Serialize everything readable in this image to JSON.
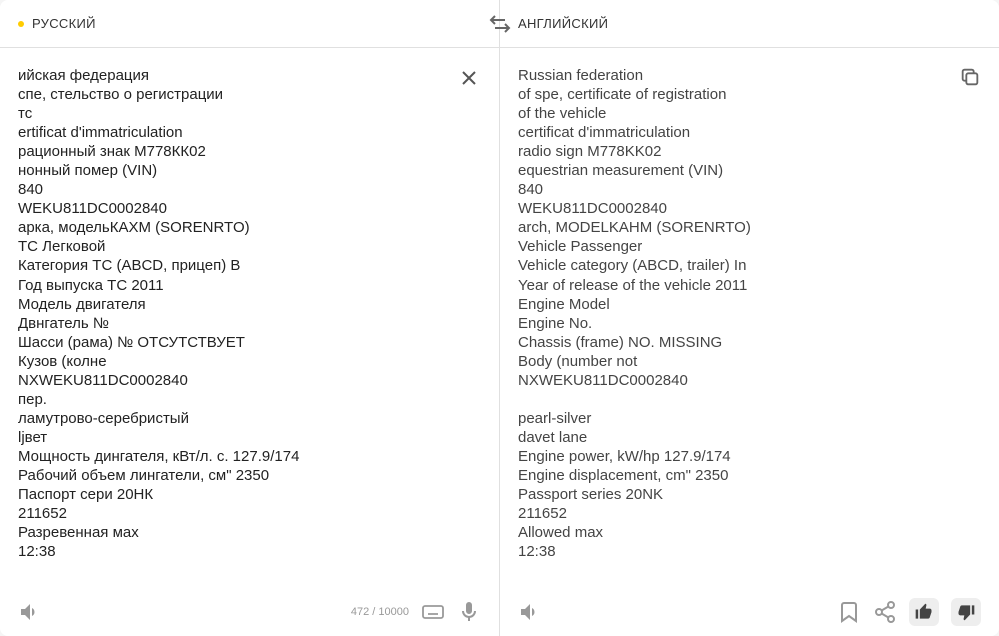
{
  "source": {
    "lang_label": "РУССКИЙ",
    "text": "ийская федерация\nспе, стельство о регистрации\nтс\nertificat d'immatriculation\nрационный знак М778КК02\nнонный помер (VIN)\n840\nWEKU811DC0002840\nарка, модельКАХМ (SORENRTO)\nТС Легковой\nКатегория ТС (ABCD, прицеп) В\nГод выпуска ТС 2011\nМодель двигателя\nДвнгатель №\nШасси (рама) № ОТСУТСТВУЕТ\nКузов (колне\nNXWEKU811DC0002840\nпер.\nламутрово-серебристый\nljвет\nМощность дингателя, кВт/л. с. 127.9/174\nРабочий объем лингатели, см\" 2350\nПаспорт сери 20НК\n211652\nРазревенная мах\n12:38",
    "char_count": "472 / 10000"
  },
  "target": {
    "lang_label": "АНГЛИЙСКИЙ",
    "text": "Russian federation\nof spe, certificate of registration\nof the vehicle\ncertificat d'immatriculation\nradio sign M778KK02\nequestrian measurement (VIN)\n840\nWEKU811DC0002840\narch, MODELKAHM (SORENRTO)\nVehicle Passenger\nVehicle category (ABCD, trailer) In\nYear of release of the vehicle 2011\nEngine Model\nEngine No.\nChassis (frame) NO. MISSING\nBody (number not\nNXWEKU811DC0002840\n\npearl-silver\ndavet lane\nEngine power, kW/hp 127.9/174\nEngine displacement, cm\" 2350\nPassport series 20NK\n211652\nAllowed max\n12:38"
  }
}
